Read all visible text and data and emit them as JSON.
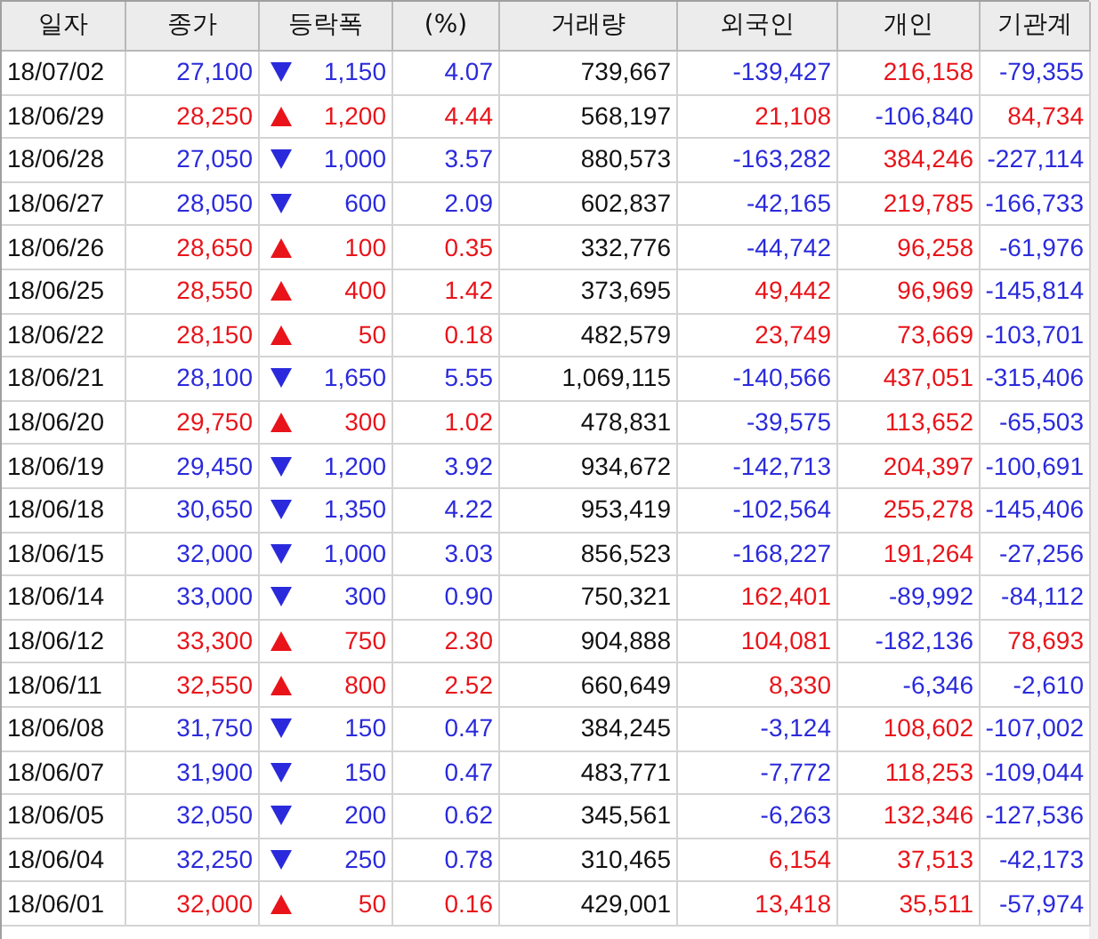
{
  "columns": [
    "일자",
    "종가",
    "등락폭",
    "(%)",
    "거래량",
    "외국인",
    "개인",
    "기관계"
  ],
  "rows": [
    {
      "date": "18/07/02",
      "close": "27,100",
      "up": false,
      "change": "1,150",
      "pct": "4.07",
      "volume": "739,667",
      "foreign": {
        "text": "-139,427",
        "up": false
      },
      "individual": {
        "text": "216,158",
        "up": true
      },
      "institution": {
        "text": "-79,355",
        "up": false
      }
    },
    {
      "date": "18/06/29",
      "close": "28,250",
      "up": true,
      "change": "1,200",
      "pct": "4.44",
      "volume": "568,197",
      "foreign": {
        "text": "21,108",
        "up": true
      },
      "individual": {
        "text": "-106,840",
        "up": false
      },
      "institution": {
        "text": "84,734",
        "up": true
      }
    },
    {
      "date": "18/06/28",
      "close": "27,050",
      "up": false,
      "change": "1,000",
      "pct": "3.57",
      "volume": "880,573",
      "foreign": {
        "text": "-163,282",
        "up": false
      },
      "individual": {
        "text": "384,246",
        "up": true
      },
      "institution": {
        "text": "-227,114",
        "up": false
      }
    },
    {
      "date": "18/06/27",
      "close": "28,050",
      "up": false,
      "change": "600",
      "pct": "2.09",
      "volume": "602,837",
      "foreign": {
        "text": "-42,165",
        "up": false
      },
      "individual": {
        "text": "219,785",
        "up": true
      },
      "institution": {
        "text": "-166,733",
        "up": false
      }
    },
    {
      "date": "18/06/26",
      "close": "28,650",
      "up": true,
      "change": "100",
      "pct": "0.35",
      "volume": "332,776",
      "foreign": {
        "text": "-44,742",
        "up": false
      },
      "individual": {
        "text": "96,258",
        "up": true
      },
      "institution": {
        "text": "-61,976",
        "up": false
      }
    },
    {
      "date": "18/06/25",
      "close": "28,550",
      "up": true,
      "change": "400",
      "pct": "1.42",
      "volume": "373,695",
      "foreign": {
        "text": "49,442",
        "up": true
      },
      "individual": {
        "text": "96,969",
        "up": true
      },
      "institution": {
        "text": "-145,814",
        "up": false
      }
    },
    {
      "date": "18/06/22",
      "close": "28,150",
      "up": true,
      "change": "50",
      "pct": "0.18",
      "volume": "482,579",
      "foreign": {
        "text": "23,749",
        "up": true
      },
      "individual": {
        "text": "73,669",
        "up": true
      },
      "institution": {
        "text": "-103,701",
        "up": false
      }
    },
    {
      "date": "18/06/21",
      "close": "28,100",
      "up": false,
      "change": "1,650",
      "pct": "5.55",
      "volume": "1,069,115",
      "foreign": {
        "text": "-140,566",
        "up": false
      },
      "individual": {
        "text": "437,051",
        "up": true
      },
      "institution": {
        "text": "-315,406",
        "up": false
      }
    },
    {
      "date": "18/06/20",
      "close": "29,750",
      "up": true,
      "change": "300",
      "pct": "1.02",
      "volume": "478,831",
      "foreign": {
        "text": "-39,575",
        "up": false
      },
      "individual": {
        "text": "113,652",
        "up": true
      },
      "institution": {
        "text": "-65,503",
        "up": false
      }
    },
    {
      "date": "18/06/19",
      "close": "29,450",
      "up": false,
      "change": "1,200",
      "pct": "3.92",
      "volume": "934,672",
      "foreign": {
        "text": "-142,713",
        "up": false
      },
      "individual": {
        "text": "204,397",
        "up": true
      },
      "institution": {
        "text": "-100,691",
        "up": false
      }
    },
    {
      "date": "18/06/18",
      "close": "30,650",
      "up": false,
      "change": "1,350",
      "pct": "4.22",
      "volume": "953,419",
      "foreign": {
        "text": "-102,564",
        "up": false
      },
      "individual": {
        "text": "255,278",
        "up": true
      },
      "institution": {
        "text": "-145,406",
        "up": false
      }
    },
    {
      "date": "18/06/15",
      "close": "32,000",
      "up": false,
      "change": "1,000",
      "pct": "3.03",
      "volume": "856,523",
      "foreign": {
        "text": "-168,227",
        "up": false
      },
      "individual": {
        "text": "191,264",
        "up": true
      },
      "institution": {
        "text": "-27,256",
        "up": false
      }
    },
    {
      "date": "18/06/14",
      "close": "33,000",
      "up": false,
      "change": "300",
      "pct": "0.90",
      "volume": "750,321",
      "foreign": {
        "text": "162,401",
        "up": true
      },
      "individual": {
        "text": "-89,992",
        "up": false
      },
      "institution": {
        "text": "-84,112",
        "up": false
      }
    },
    {
      "date": "18/06/12",
      "close": "33,300",
      "up": true,
      "change": "750",
      "pct": "2.30",
      "volume": "904,888",
      "foreign": {
        "text": "104,081",
        "up": true
      },
      "individual": {
        "text": "-182,136",
        "up": false
      },
      "institution": {
        "text": "78,693",
        "up": true
      }
    },
    {
      "date": "18/06/11",
      "close": "32,550",
      "up": true,
      "change": "800",
      "pct": "2.52",
      "volume": "660,649",
      "foreign": {
        "text": "8,330",
        "up": true
      },
      "individual": {
        "text": "-6,346",
        "up": false
      },
      "institution": {
        "text": "-2,610",
        "up": false
      }
    },
    {
      "date": "18/06/08",
      "close": "31,750",
      "up": false,
      "change": "150",
      "pct": "0.47",
      "volume": "384,245",
      "foreign": {
        "text": "-3,124",
        "up": false
      },
      "individual": {
        "text": "108,602",
        "up": true
      },
      "institution": {
        "text": "-107,002",
        "up": false
      }
    },
    {
      "date": "18/06/07",
      "close": "31,900",
      "up": false,
      "change": "150",
      "pct": "0.47",
      "volume": "483,771",
      "foreign": {
        "text": "-7,772",
        "up": false
      },
      "individual": {
        "text": "118,253",
        "up": true
      },
      "institution": {
        "text": "-109,044",
        "up": false
      }
    },
    {
      "date": "18/06/05",
      "close": "32,050",
      "up": false,
      "change": "200",
      "pct": "0.62",
      "volume": "345,561",
      "foreign": {
        "text": "-6,263",
        "up": false
      },
      "individual": {
        "text": "132,346",
        "up": true
      },
      "institution": {
        "text": "-127,536",
        "up": false
      }
    },
    {
      "date": "18/06/04",
      "close": "32,250",
      "up": false,
      "change": "250",
      "pct": "0.78",
      "volume": "310,465",
      "foreign": {
        "text": "6,154",
        "up": true
      },
      "individual": {
        "text": "37,513",
        "up": true
      },
      "institution": {
        "text": "-42,173",
        "up": false
      }
    },
    {
      "date": "18/06/01",
      "close": "32,000",
      "up": true,
      "change": "50",
      "pct": "0.16",
      "volume": "429,001",
      "foreign": {
        "text": "13,418",
        "up": true
      },
      "individual": {
        "text": "35,511",
        "up": true
      },
      "institution": {
        "text": "-57,974",
        "up": false
      }
    }
  ]
}
